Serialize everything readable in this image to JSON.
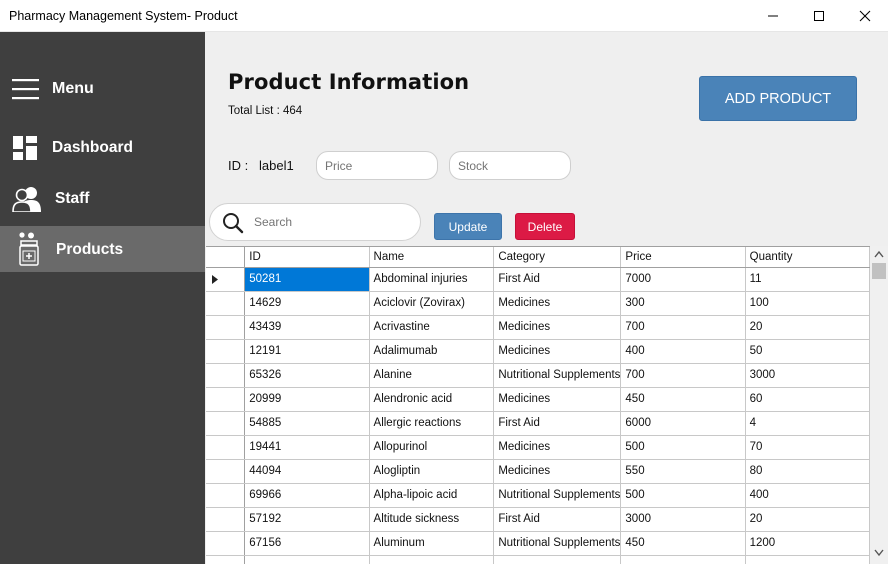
{
  "window": {
    "title": "Pharmacy Management System- Product"
  },
  "sidebar": {
    "menu_label": "Menu",
    "items": [
      {
        "label": "Dashboard",
        "icon": "dashboard-icon"
      },
      {
        "label": "Staff",
        "icon": "staff-icon"
      },
      {
        "label": "Products",
        "icon": "medicine-bottle-icon",
        "active": true
      }
    ]
  },
  "header": {
    "title": "Product Information",
    "total_label": "Total List : 464",
    "add_button": "ADD PRODUCT"
  },
  "form": {
    "id_label": "ID :",
    "id_value": "label1",
    "price_placeholder": "Price",
    "stock_placeholder": "Stock"
  },
  "search": {
    "placeholder": "Search"
  },
  "actions": {
    "update": "Update",
    "delete": "Delete"
  },
  "table": {
    "columns": [
      "ID",
      "Name",
      "Category",
      "Price",
      "Quantity"
    ],
    "rows": [
      [
        "50281",
        "Abdominal injuries",
        "First Aid",
        "7000",
        "11"
      ],
      [
        "14629",
        "Aciclovir (Zovirax)",
        "Medicines",
        "300",
        "100"
      ],
      [
        "43439",
        "Acrivastine",
        "Medicines",
        "700",
        "20"
      ],
      [
        "12191",
        "Adalimumab",
        "Medicines",
        "400",
        "50"
      ],
      [
        "65326",
        "Alanine",
        "Nutritional Supplements",
        "700",
        "3000"
      ],
      [
        "20999",
        "Alendronic acid",
        "Medicines",
        "450",
        "60"
      ],
      [
        "54885",
        "Allergic reactions",
        "First Aid",
        "6000",
        "4"
      ],
      [
        "19441",
        "Allopurinol",
        "Medicines",
        "500",
        "70"
      ],
      [
        "44094",
        "Alogliptin",
        "Medicines",
        "550",
        "80"
      ],
      [
        "69966",
        "Alpha-lipoic acid",
        "Nutritional Supplements",
        "500",
        "400"
      ],
      [
        "57192",
        "Altitude sickness",
        "First Aid",
        "3000",
        "20"
      ],
      [
        "67156",
        "Aluminum",
        "Nutritional Supplements",
        "450",
        "1200"
      ],
      [
        "",
        "",
        "",
        "",
        ""
      ]
    ]
  },
  "colors": {
    "sidebar_bg": "#3f3f3f",
    "sidebar_active": "#6a6a6a",
    "primary_button": "#4a83b8",
    "delete_button": "#dc1a45",
    "selection": "#0078d7"
  }
}
